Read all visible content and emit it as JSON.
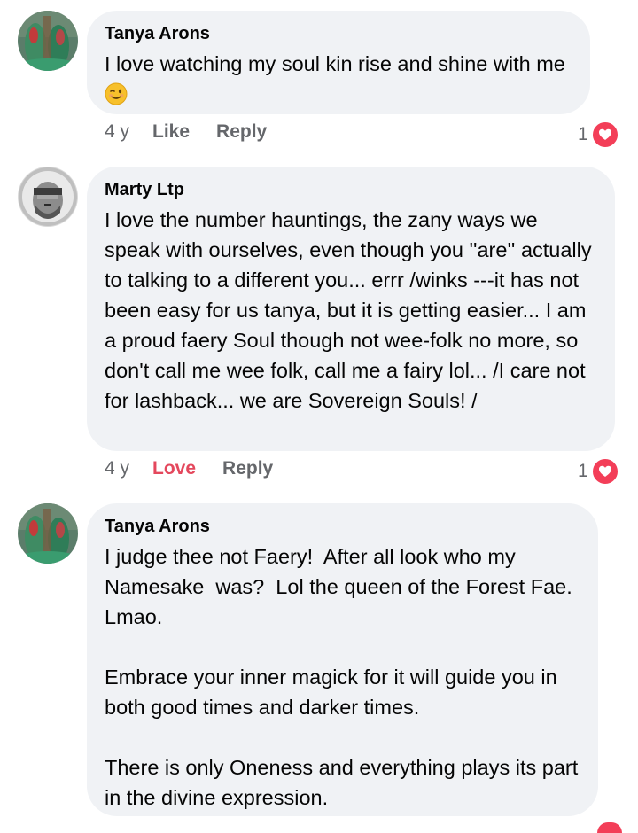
{
  "comments": [
    {
      "author": "Tanya Arons",
      "text": "I love watching my soul kin rise and shine with me",
      "emoji": "winking-face",
      "age": "4 y",
      "like_label": "Like",
      "reply_label": "Reply",
      "reaction_count": "1",
      "reaction_type": "love"
    },
    {
      "author": "Marty Ltp",
      "text": "I love the number hauntings, the zany ways we speak with ourselves, even though you ''are'' actually to talking to a different you... errr /winks ---it has not been easy for us tanya, but it is getting easier... I am a proud faery Soul though not wee-folk no more, so don't call me wee folk, call me a fairy lol... /I care not for lashback... we are Sovereign Souls! /",
      "age": "4 y",
      "love_label": "Love",
      "reply_label": "Reply",
      "reaction_count": "1",
      "reaction_type": "love"
    },
    {
      "author": "Tanya Arons",
      "paragraphs": [
        "I judge thee not Faery!  After all look who my Namesake  was?  Lol the queen of the Forest Fae.  Lmao.",
        "Embrace your inner magick for it will guide you in both good times and darker times.",
        "There is only Oneness and everything plays its part in the divine expression."
      ]
    }
  ],
  "colors": {
    "bubble_bg": "#f0f2f5",
    "meta_text": "#65676b",
    "love_red": "#e4485d",
    "heart_badge": "#f33e58"
  },
  "icons": {
    "reaction": "heart-icon",
    "emoji": "winking-face-emoji"
  }
}
